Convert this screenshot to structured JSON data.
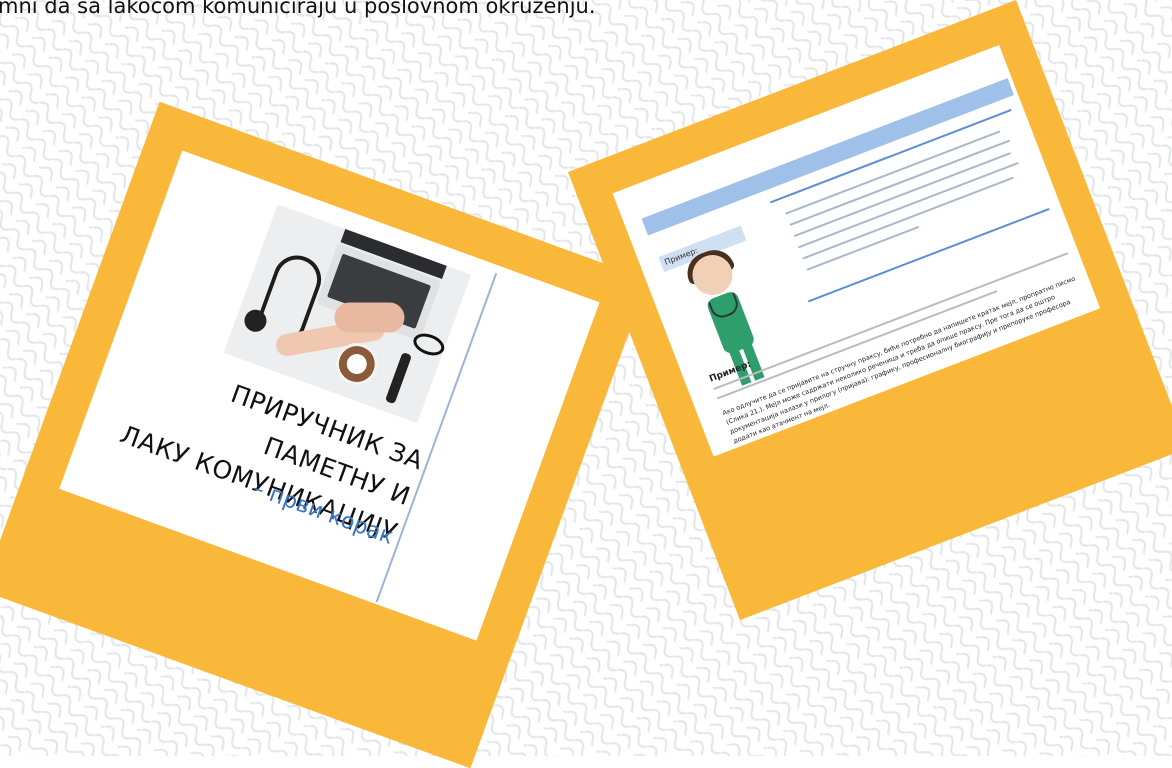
{
  "intro_text": "mni da sa lakoćom komuniciraju u poslovnom okruženju.",
  "colors": {
    "polaroid_frame": "#f9b83a",
    "pattern_line": "#e3e7ea",
    "subtitle_blue": "#3b76c4",
    "banner_blue": "#9fc0e8"
  },
  "cover": {
    "title_line1": "ПРИРУЧНИК ЗА ПАМЕТНУ И",
    "title_line2": "ЛАКУ КОМУНИКАЦИЈУ",
    "subtitle": "– први корак",
    "image_icon": "laptop-stethoscope-coffee-photo"
  },
  "inner_page": {
    "banner_label": "Пример:",
    "example_label": "Пример:",
    "paragraph": "Ако одлучите да се пријавите на стручну праксу, биће потребно да напишете кратак мејл, пропратно писмо (Слика 21.). Мејл може садржати неколико реченица и треба да опише праксу. Пре тога да се оштро документација налази у прилогу (пријава): графику, професионалну биографију и препоруке професора додати као атачмент на мејл."
  }
}
